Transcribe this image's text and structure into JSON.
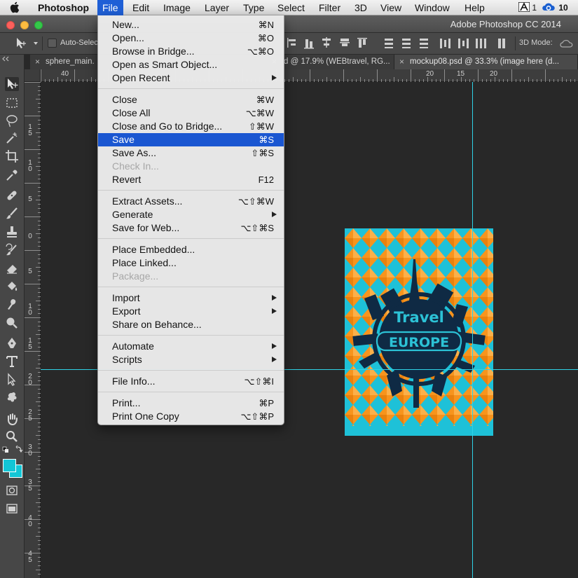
{
  "menubar": {
    "app": "Photoshop",
    "items": [
      "File",
      "Edit",
      "Image",
      "Layer",
      "Type",
      "Select",
      "Filter",
      "3D",
      "View",
      "Window",
      "Help"
    ],
    "status": {
      "adobe_count": "1",
      "cc_count": "10"
    }
  },
  "window": {
    "title": "Adobe Photoshop CC 2014"
  },
  "options": {
    "auto_select_label": "Auto-Selec",
    "mode_3d_label": "3D Mode:"
  },
  "tabs": [
    {
      "label": "sphere_main."
    },
    {
      "label": "d @ 17.9% (WEBtravel, RG..."
    },
    {
      "label": "mockup08.psd @ 33.3% (image here (d..."
    }
  ],
  "ruler_top": [
    "40",
    "20",
    "15",
    "20"
  ],
  "ruler_left": [
    "1|5",
    "1|0",
    "5",
    "0",
    "5",
    "1|0",
    "1|5",
    "2|0",
    "2|5",
    "3|0",
    "3|5",
    "4|0",
    "4|5"
  ],
  "file_menu": {
    "items": [
      {
        "label": "New...",
        "shortcut": "⌘N"
      },
      {
        "label": "Open...",
        "shortcut": "⌘O"
      },
      {
        "label": "Browse in Bridge...",
        "shortcut": "⌥⌘O"
      },
      {
        "label": "Open as Smart Object...",
        "shortcut": ""
      },
      {
        "label": "Open Recent",
        "shortcut": "",
        "submenu": true
      },
      {
        "sep": true
      },
      {
        "label": "Close",
        "shortcut": "⌘W"
      },
      {
        "label": "Close All",
        "shortcut": "⌥⌘W"
      },
      {
        "label": "Close and Go to Bridge...",
        "shortcut": "⇧⌘W"
      },
      {
        "label": "Save",
        "shortcut": "⌘S",
        "highlighted": true
      },
      {
        "label": "Save As...",
        "shortcut": "⇧⌘S"
      },
      {
        "label": "Check In...",
        "shortcut": "",
        "disabled": true
      },
      {
        "label": "Revert",
        "shortcut": "F12"
      },
      {
        "sep": true
      },
      {
        "label": "Extract Assets...",
        "shortcut": "⌥⇧⌘W"
      },
      {
        "label": "Generate",
        "shortcut": "",
        "submenu": true
      },
      {
        "label": "Save for Web...",
        "shortcut": "⌥⇧⌘S"
      },
      {
        "sep": true
      },
      {
        "label": "Place Embedded...",
        "shortcut": ""
      },
      {
        "label": "Place Linked...",
        "shortcut": ""
      },
      {
        "label": "Package...",
        "shortcut": "",
        "disabled": true
      },
      {
        "sep": true
      },
      {
        "label": "Import",
        "shortcut": "",
        "submenu": true
      },
      {
        "label": "Export",
        "shortcut": "",
        "submenu": true
      },
      {
        "label": "Share on Behance...",
        "shortcut": ""
      },
      {
        "sep": true
      },
      {
        "label": "Automate",
        "shortcut": "",
        "submenu": true
      },
      {
        "label": "Scripts",
        "shortcut": "",
        "submenu": true
      },
      {
        "sep": true
      },
      {
        "label": "File Info...",
        "shortcut": "⌥⇧⌘I"
      },
      {
        "sep": true
      },
      {
        "label": "Print...",
        "shortcut": "⌘P"
      },
      {
        "label": "Print One Copy",
        "shortcut": "⌥⇧⌘P"
      }
    ]
  },
  "poster": {
    "line1": "Travel",
    "line2": "EUROPE"
  },
  "colors": {
    "menu_highlight": "#1a56d1",
    "guide": "#2fd3e6",
    "poster_orange": "#f7941d",
    "poster_cyan": "#1ec1d8",
    "poster_navy": "#0f2a44",
    "poster_text": "#2cc2d6",
    "foreground_swatch": "#12c6d6",
    "background_swatch": "#12c6d6"
  },
  "icons": {
    "apple": "apple-icon",
    "move_tool": "move-tool-icon",
    "creative_cloud": "creative-cloud-icon"
  }
}
